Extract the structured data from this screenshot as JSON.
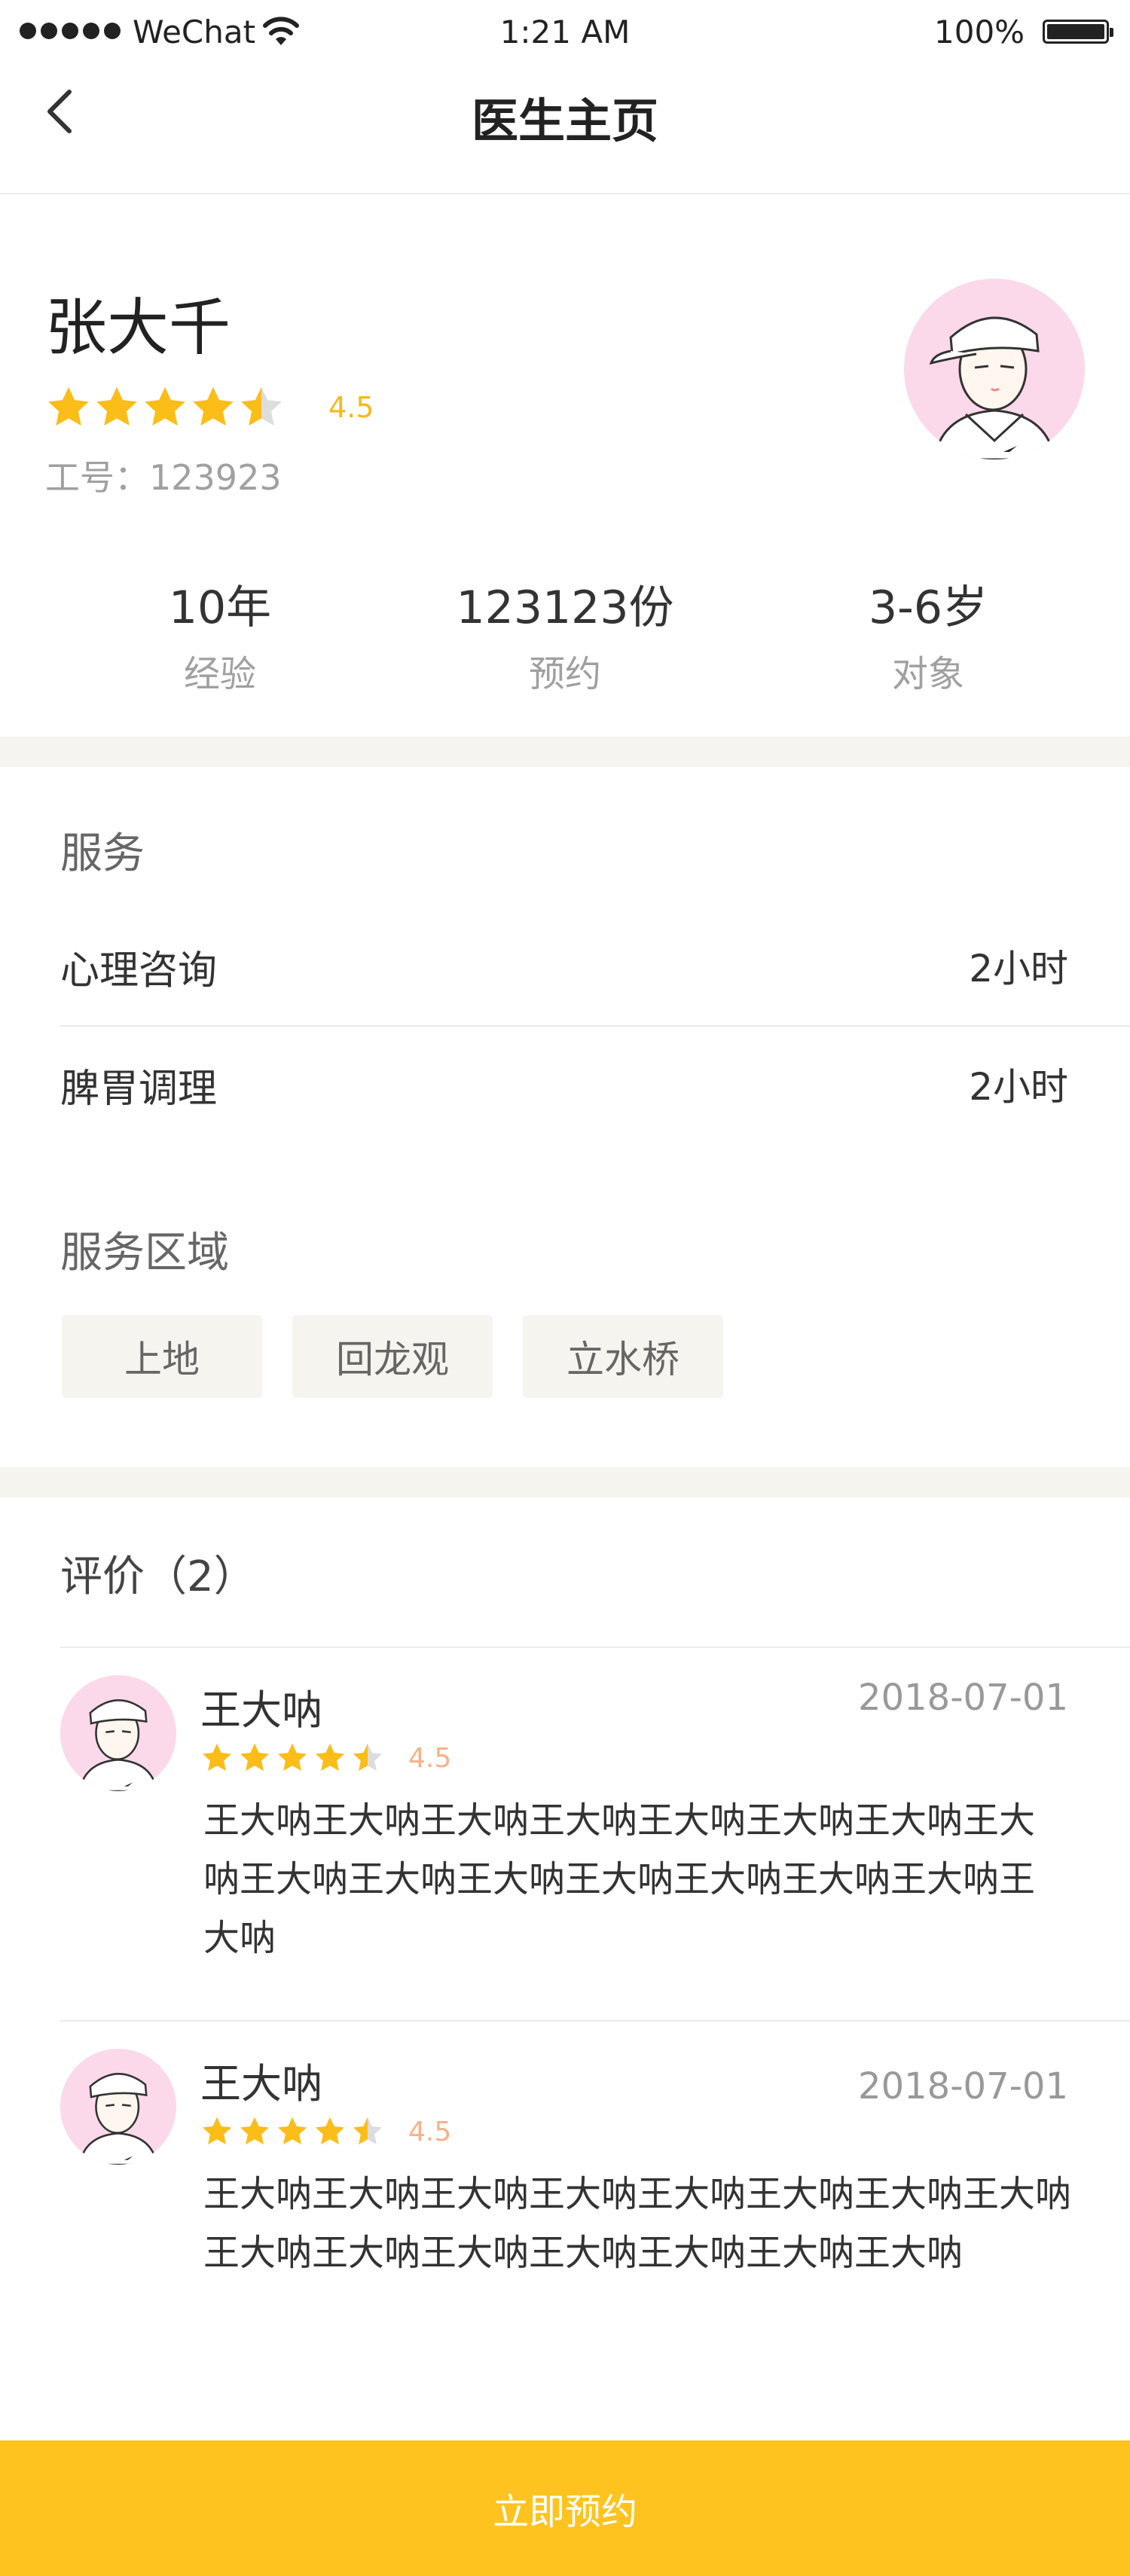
{
  "status_bar": {
    "carrier": "WeChat",
    "time": "1:21 AM",
    "battery": "100%"
  },
  "nav": {
    "title": "医生主页"
  },
  "doctor": {
    "name": "张大千",
    "rating": 4.5,
    "rating_text": "4.5",
    "employee_id": "工号：123923"
  },
  "stats": [
    {
      "value": "10年",
      "label": "经验"
    },
    {
      "value": "123123份",
      "label": "预约"
    },
    {
      "value": "3-6岁",
      "label": "对象"
    }
  ],
  "services": {
    "title": "服务",
    "items": [
      {
        "name": "心理咨询",
        "duration": "2小时"
      },
      {
        "name": "脾胃调理",
        "duration": "2小时"
      }
    ],
    "area_title": "服务区域",
    "areas": [
      "上地",
      "回龙观",
      "立水桥"
    ]
  },
  "reviews": {
    "title": "评价（2）",
    "items": [
      {
        "reviewer": "王大呐",
        "date": "2018-07-01",
        "rating": 4.5,
        "rating_text": "4.5",
        "content": "王大呐王大呐王大呐王大呐王大呐王大呐王大呐王大呐王大呐王大呐王大呐王大呐王大呐王大呐王大呐王大呐"
      },
      {
        "reviewer": "王大呐",
        "date": "2018-07-01",
        "rating": 4.5,
        "rating_text": "4.5",
        "content": "王大呐王大呐王大呐王大呐王大呐王大呐王大呐王大呐王大呐王大呐王大呐王大呐王大呐王大呐王大呐"
      }
    ]
  },
  "actions": {
    "book_label": "立即预约"
  },
  "colors": {
    "accent": "#fec31e",
    "star": "#fbbd18",
    "avatar_bg": "#fbd9ea"
  }
}
